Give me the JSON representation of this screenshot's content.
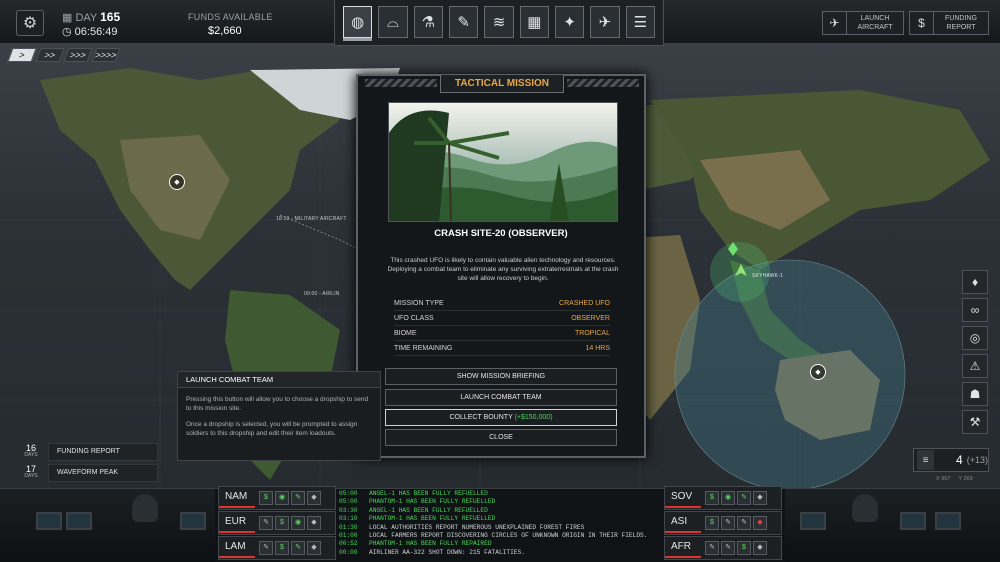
{
  "topbar": {
    "day_label": "DAY",
    "day_value": "165",
    "clock": "06:56:49",
    "funds_label": "FUNDS AVAILABLE",
    "funds_value": "$2,660",
    "launch_aircraft": "LAUNCH AIRCRAFT",
    "funding_report": "FUNDING REPORT",
    "tabs": [
      "geoscape-icon",
      "hangar-icon",
      "research-icon",
      "engineering-icon",
      "soldiers-icon",
      "base-icon",
      "weapons-icon",
      "aircraft-icon",
      "archive-icon"
    ]
  },
  "speed": [
    ">",
    ">>",
    ">>>",
    ">>>>"
  ],
  "map": {
    "flight_1": "18:10 - MILITARY AIRCRAFT",
    "flight_2": "00:00 - AIRLIN",
    "skyhawk": "SKYHAWK-1"
  },
  "mission": {
    "header": "TACTICAL MISSION",
    "site": "CRASH SITE-20 (OBSERVER)",
    "description": "This crashed UFO is likely to contain valuable alien technology and resources. Deploying a combat team to eliminate any surviving extraterrestrials at the crash site will allow recovery to begin.",
    "stats": [
      {
        "k": "MISSION TYPE",
        "v": "CRASHED UFO"
      },
      {
        "k": "UFO CLASS",
        "v": "OBSERVER"
      },
      {
        "k": "BIOME",
        "v": "TROPICAL"
      },
      {
        "k": "TIME REMAINING",
        "v": "14 HRS"
      }
    ],
    "btn_briefing": "SHOW MISSION BRIEFING",
    "btn_launch": "LAUNCH COMBAT TEAM",
    "btn_bounty": "COLLECT BOUNTY",
    "bounty_value": "(+$150,000)",
    "btn_close": "CLOSE"
  },
  "tooltip": {
    "title": "LAUNCH COMBAT TEAM",
    "p1": "Pressing this button will allow you to choose a dropship to send to this mission site.",
    "p2": "Once a dropship is selected, you will be prompted to assign soldiers to this dropship and edit their item loadouts."
  },
  "reports": [
    {
      "days": "16",
      "unit": "DAYS",
      "label": "FUNDING REPORT"
    },
    {
      "days": "17",
      "unit": "DAYS",
      "label": "WAVEFORM PEAK"
    }
  ],
  "count": {
    "value": "4",
    "plus": "(+13)"
  },
  "coords": {
    "x": "X 967",
    "y": "Y 269"
  },
  "regions_left": [
    "NAM",
    "EUR",
    "LAM"
  ],
  "regions_right": [
    "SOV",
    "ASI",
    "AFR"
  ],
  "log": [
    {
      "t": "05:00",
      "m": "ANGEL-1 HAS BEEN FULLY REFUELLED",
      "c": "g"
    },
    {
      "t": "05:00",
      "m": "PHANTOM-1 HAS BEEN FULLY REFUELLED",
      "c": "g"
    },
    {
      "t": "03:30",
      "m": "ANGEL-1 HAS BEEN FULLY REFUELLED",
      "c": "g"
    },
    {
      "t": "03:10",
      "m": "PHANTOM-1 HAS BEEN FULLY REFUELLED",
      "c": "g"
    },
    {
      "t": "01:30",
      "m": "LOCAL AUTHORITIES REPORT NUMEROUS UNEXPLAINED FOREST FIRES",
      "c": "w"
    },
    {
      "t": "01:00",
      "m": "LOCAL FARMERS REPORT DISCOVERING CIRCLES OF UNKNOWN ORIGIN IN THEIR FIELDS.",
      "c": "w"
    },
    {
      "t": "00:52",
      "m": "PHANTOM-1 HAS BEEN FULLY REPAIRED",
      "c": "g"
    },
    {
      "t": "00:00",
      "m": "AIRLINER AA-322 SHOT DOWN: 215 FATALITIES.",
      "c": "w"
    }
  ]
}
